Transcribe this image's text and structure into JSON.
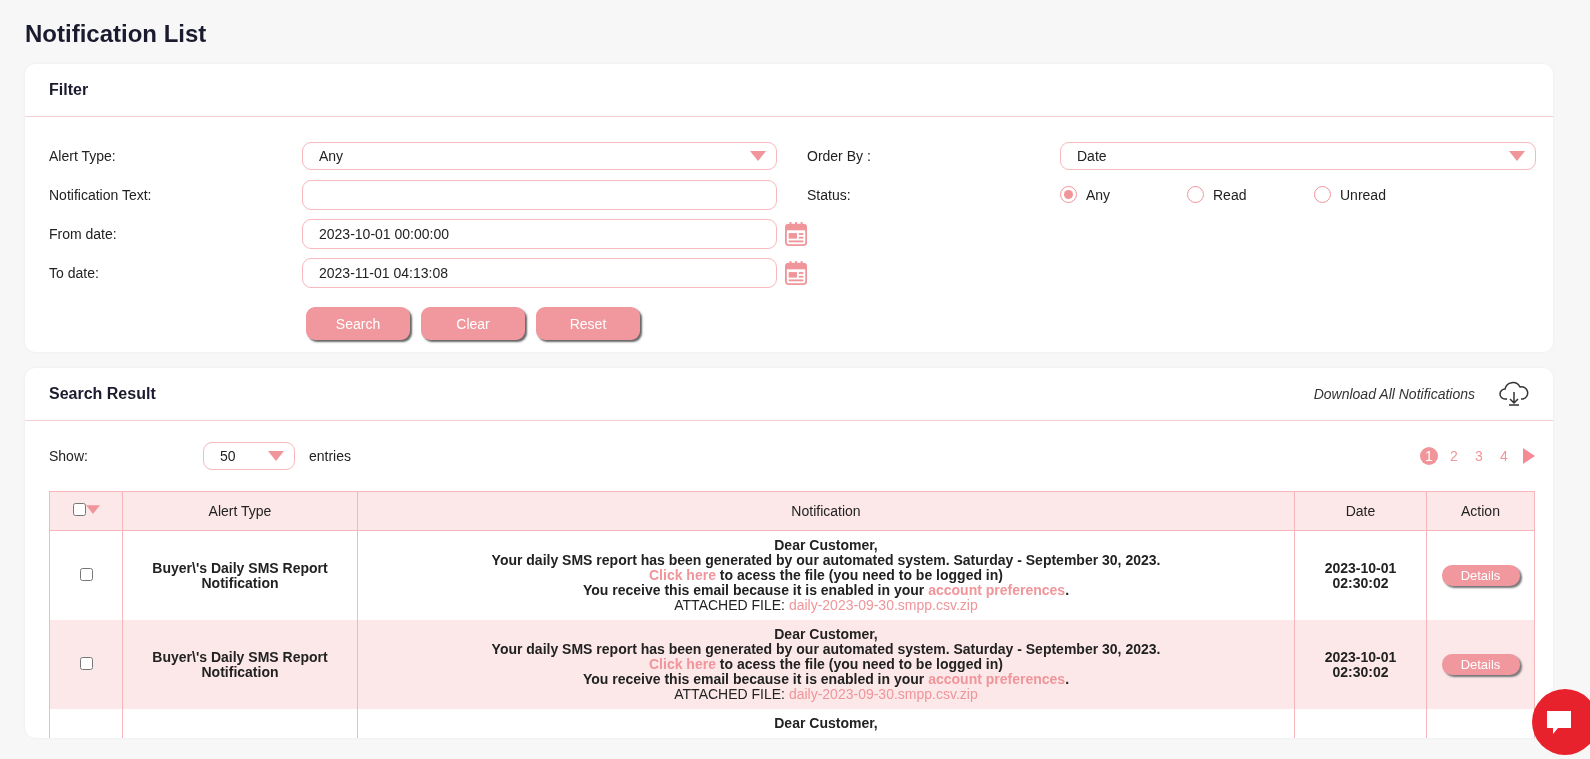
{
  "page_title": "Notification List",
  "filter": {
    "title": "Filter",
    "alert_type": {
      "label": "Alert Type:",
      "value": "Any"
    },
    "notification_text": {
      "label": "Notification Text:"
    },
    "from_date": {
      "label": "From date:",
      "value": "2023-10-01 00:00:00"
    },
    "to_date": {
      "label": "To date:",
      "value": "2023-11-01 04:13:08"
    },
    "order_by": {
      "label": "Order By :",
      "value": "Date"
    },
    "status": {
      "label": "Status:",
      "options": [
        {
          "label": "Any",
          "selected": true
        },
        {
          "label": "Read",
          "selected": false
        },
        {
          "label": "Unread",
          "selected": false
        }
      ]
    },
    "buttons": [
      "Search",
      "Clear",
      "Reset"
    ]
  },
  "results": {
    "title": "Search Result",
    "download_label": "Download All Notifications",
    "show_label": "Show:",
    "page_size": "50",
    "entries_label": "entries",
    "pages": [
      {
        "label": "1",
        "selected": true
      },
      {
        "label": "2",
        "selected": false
      },
      {
        "label": "3",
        "selected": false
      },
      {
        "label": "4",
        "selected": false
      }
    ],
    "columns": [
      "Alert Type",
      "Notification",
      "Date",
      "Action"
    ],
    "select_all_checked": false,
    "rows": [
      {
        "checked": false,
        "alert_type": "Buyer\\'s Daily SMS Report Notification",
        "greeting": "Dear Customer,",
        "body": "Your daily SMS report has been generated by our automated system. Saturday - September 30, 2023.",
        "link_text": "Click here",
        "link_rest": " to acess the file (you need to be logged in)",
        "pref_text": "You receive this email because it is enabled in your ",
        "pref_link": "account preferences",
        "pref_end": ".",
        "attached_label": "ATTACHED FILE: ",
        "attached_file": "daily-2023-09-30.smpp.csv.zip",
        "date": "2023-10-01 02:30:02",
        "action": "Details"
      },
      {
        "checked": false,
        "alert_type": "Buyer\\'s Daily SMS Report Notification",
        "greeting": "Dear Customer,",
        "body": "Your daily SMS report has been generated by our automated system. Saturday - September 30, 2023.",
        "link_text": "Click here",
        "link_rest": " to acess the file (you need to be logged in)",
        "pref_text": "You receive this email because it is enabled in your ",
        "pref_link": "account preferences",
        "pref_end": ".",
        "attached_label": "ATTACHED FILE: ",
        "attached_file": "daily-2023-09-30.smpp.csv.zip",
        "date": "2023-10-01 02:30:02",
        "action": "Details"
      },
      {
        "greeting": "Dear Customer,"
      }
    ]
  }
}
